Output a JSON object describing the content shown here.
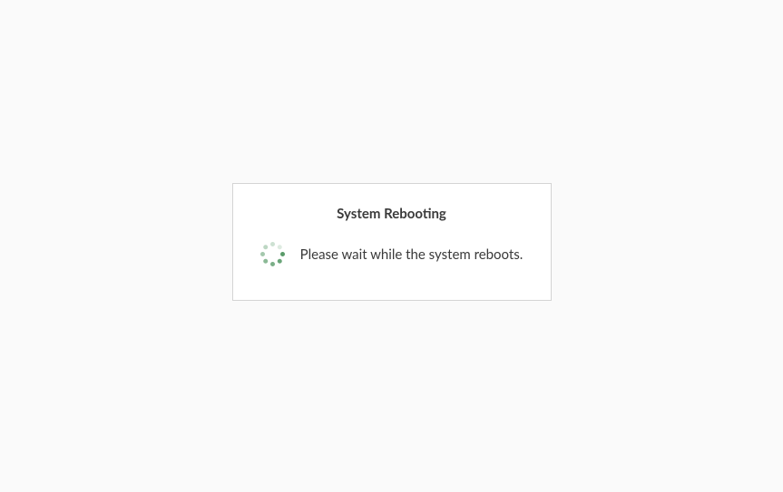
{
  "dialog": {
    "title": "System Rebooting",
    "message": "Please wait while the system reboots."
  }
}
